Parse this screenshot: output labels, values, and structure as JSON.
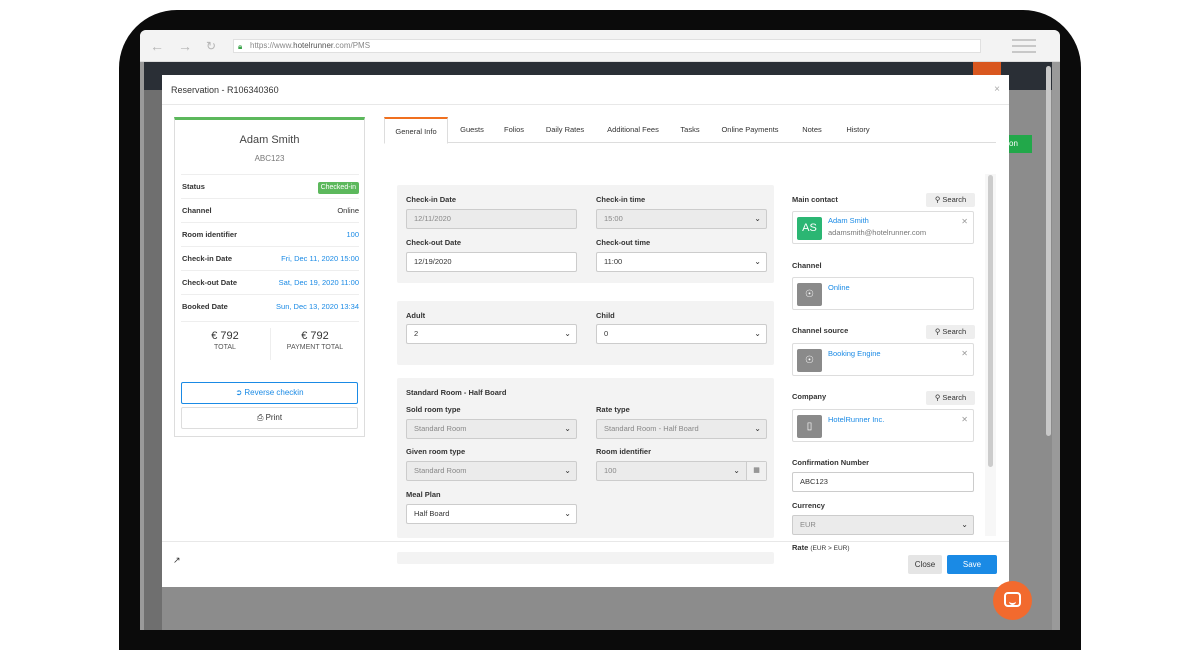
{
  "browser": {
    "back_icon": "arrow-left-icon",
    "forward_icon": "arrow-right-icon",
    "reload_icon": "reload-icon",
    "url_prefix": "https://www.",
    "url_host": "hotelrunner",
    "url_suffix": ".com/PMS"
  },
  "app": {
    "corner_tag": "on"
  },
  "modal": {
    "title": "Reservation - R106340360",
    "close_glyph": "×",
    "footer": {
      "close_label": "Close",
      "save_label": "Save"
    }
  },
  "summary": {
    "guest_name": "Adam Smith",
    "guest_code": "ABC123",
    "rows": [
      {
        "key": "Status",
        "value": "Checked-in"
      },
      {
        "key": "Channel",
        "value": "Online"
      },
      {
        "key": "Room identifier",
        "value": "100"
      },
      {
        "key": "Check-in Date",
        "value": "Fri, Dec 11, 2020 15:00"
      },
      {
        "key": "Check-out Date",
        "value": "Sat, Dec 19, 2020 11:00"
      },
      {
        "key": "Booked Date",
        "value": "Sun, Dec 13, 2020 13:34"
      }
    ],
    "total": {
      "amount": "€ 792",
      "label": "TOTAL"
    },
    "payment_total": {
      "amount": "€ 792",
      "label": "PAYMENT TOTAL"
    },
    "reverse_checkin_label": "Reverse checkin",
    "print_label": "Print"
  },
  "tabs": [
    "General Info",
    "Guests",
    "Folios",
    "Daily Rates",
    "Additional Fees",
    "Tasks",
    "Online Payments",
    "Notes",
    "History"
  ],
  "dates": {
    "checkin_date_label": "Check-in Date",
    "checkin_date_value": "12/11/2020",
    "checkin_time_label": "Check-in time",
    "checkin_time_value": "15:00",
    "checkout_date_label": "Check-out Date",
    "checkout_date_value": "12/19/2020",
    "checkout_time_label": "Check-out time",
    "checkout_time_value": "11:00"
  },
  "occupancy": {
    "adult_label": "Adult",
    "adult_value": "2",
    "child_label": "Child",
    "child_value": "0"
  },
  "room": {
    "title": "Standard Room - Half Board",
    "sold_room_type_label": "Sold room type",
    "sold_room_type_value": "Standard Room",
    "rate_type_label": "Rate type",
    "rate_type_value": "Standard Room - Half Board",
    "given_room_type_label": "Given room type",
    "given_room_type_value": "Standard Room",
    "room_identifier_label": "Room identifier",
    "room_identifier_value": "100",
    "meal_plan_label": "Meal Plan",
    "meal_plan_value": "Half Board"
  },
  "right": {
    "main_contact_label": "Main contact",
    "search_label": "Search",
    "contact_initials": "AS",
    "contact_name": "Adam Smith",
    "contact_email": "adamsmith@hotelrunner.com",
    "channel_label": "Channel",
    "channel_value": "Online",
    "channel_source_label": "Channel source",
    "channel_source_value": "Booking Engine",
    "company_label": "Company",
    "company_value": "HotelRunner  Inc.",
    "confirmation_label": "Confirmation Number",
    "confirmation_value": "ABC123",
    "currency_label": "Currency",
    "currency_value": "EUR",
    "rate_label": "Rate",
    "rate_sub": "(EUR > EUR)"
  },
  "colors": {
    "accent": "#1a8ae5",
    "status_green": "#5cb85c",
    "tab_active": "#f0701f",
    "chat": "#f26a2e",
    "avatar_green": "#2bb673"
  }
}
